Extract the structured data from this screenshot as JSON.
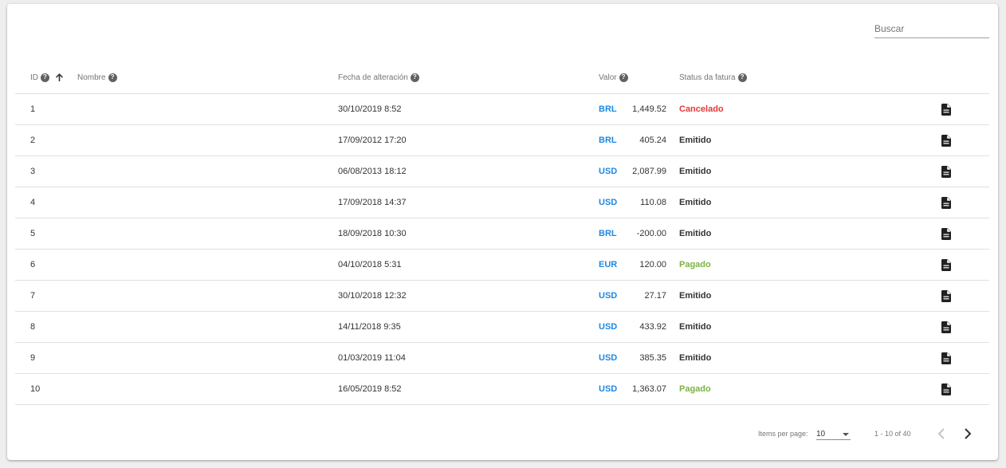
{
  "search": {
    "placeholder": "Buscar",
    "value": ""
  },
  "columns": {
    "id": "ID",
    "name": "Nombre",
    "date": "Fecha de alteración",
    "value": "Valor",
    "status": "Status da fatura"
  },
  "colors": {
    "currency": "#1e88e5",
    "cancelado": "#e53935",
    "emitido": "#333333",
    "pagado": "#7cb342"
  },
  "rows": [
    {
      "id": "1",
      "date": "30/10/2019 8:52",
      "currency": "BRL",
      "value": "1,449.52",
      "status": "Cancelado",
      "status_color": "#e53935"
    },
    {
      "id": "2",
      "date": "17/09/2012 17:20",
      "currency": "BRL",
      "value": "405.24",
      "status": "Emitido",
      "status_color": "#333333"
    },
    {
      "id": "3",
      "date": "06/08/2013 18:12",
      "currency": "USD",
      "value": "2,087.99",
      "status": "Emitido",
      "status_color": "#333333"
    },
    {
      "id": "4",
      "date": "17/09/2018 14:37",
      "currency": "USD",
      "value": "110.08",
      "status": "Emitido",
      "status_color": "#333333"
    },
    {
      "id": "5",
      "date": "18/09/2018 10:30",
      "currency": "BRL",
      "value": "-200.00",
      "status": "Emitido",
      "status_color": "#333333"
    },
    {
      "id": "6",
      "date": "04/10/2018 5:31",
      "currency": "EUR",
      "value": "120.00",
      "status": "Pagado",
      "status_color": "#7cb342"
    },
    {
      "id": "7",
      "date": "30/10/2018 12:32",
      "currency": "USD",
      "value": "27.17",
      "status": "Emitido",
      "status_color": "#333333"
    },
    {
      "id": "8",
      "date": "14/11/2018 9:35",
      "currency": "USD",
      "value": "433.92",
      "status": "Emitido",
      "status_color": "#333333"
    },
    {
      "id": "9",
      "date": "01/03/2019 11:04",
      "currency": "USD",
      "value": "385.35",
      "status": "Emitido",
      "status_color": "#333333"
    },
    {
      "id": "10",
      "date": "16/05/2019 8:52",
      "currency": "USD",
      "value": "1,363.07",
      "status": "Pagado",
      "status_color": "#7cb342"
    }
  ],
  "paginator": {
    "items_label": "Items per page:",
    "page_size": "10",
    "range": "1 - 10 of 40"
  },
  "icons": {
    "help": "help-circle-icon",
    "sort": "arrow-up-icon",
    "document": "document-icon",
    "prev": "chevron-left-icon",
    "next": "chevron-right-icon"
  }
}
